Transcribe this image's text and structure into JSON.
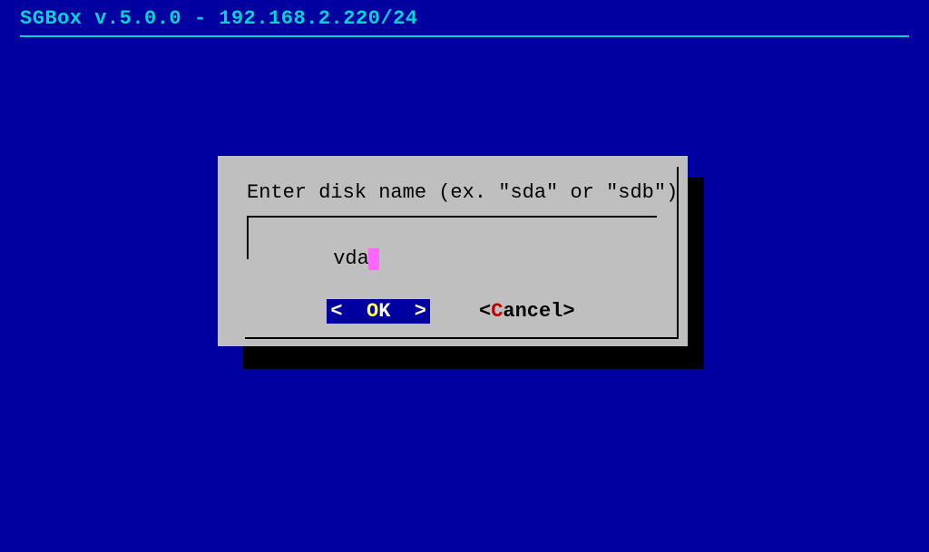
{
  "header": {
    "title": "SGBox v.5.0.0 - 192.168.2.220/24"
  },
  "dialog": {
    "prompt": "Enter disk name (ex. \"sda\" or \"sdb\")",
    "input_value": "vda",
    "buttons": {
      "ok": {
        "bracket_open": "<  ",
        "hl": "O",
        "rest": "K",
        "bracket_close": "  >",
        "selected": true
      },
      "cancel": {
        "bracket_open": "<",
        "hl": "C",
        "rest": "ancel",
        "bracket_close": ">",
        "selected": false
      }
    }
  },
  "colors": {
    "bg": "#0000a0",
    "header_text": "#00d4d4",
    "dialog_bg": "#bfbfbf",
    "cursor": "#ff66ff",
    "ok_hl": "#ffff55",
    "cancel_hl": "#c00000"
  }
}
